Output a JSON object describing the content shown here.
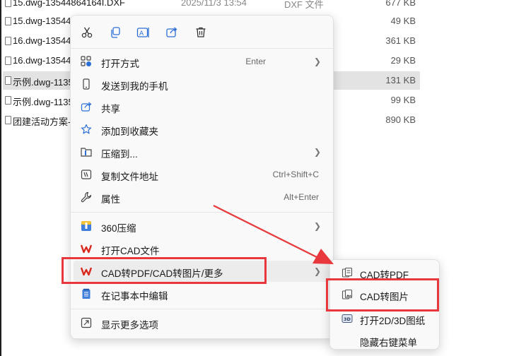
{
  "files": [
    {
      "name": "15.dwg-13544864164I.DXF",
      "date": "2025/11/3 13:54",
      "type": "DXF 文件",
      "size": "677 KB",
      "selected": false
    },
    {
      "name": "15.dwg-13544",
      "date": "",
      "type": "‡",
      "size": "49 KB",
      "selected": false
    },
    {
      "name": "16.dwg-13544",
      "date": "",
      "type": "‡",
      "size": "361 KB",
      "selected": false
    },
    {
      "name": "16.dwg-13544",
      "date": "",
      "type": "‡",
      "size": "29 KB",
      "selected": false
    },
    {
      "name": "示例.dwg-1135",
      "date": "",
      "type": "",
      "size": "131 KB",
      "selected": true
    },
    {
      "name": "示例.dwg-1135",
      "date": "",
      "type": "",
      "size": "99 KB",
      "selected": false
    },
    {
      "name": "团建活动方案-1",
      "date": "",
      "type": "",
      "size": "890 KB",
      "selected": false
    }
  ],
  "quick_actions": [
    "cut-icon",
    "copy-icon",
    "rename-icon",
    "share-icon",
    "delete-icon"
  ],
  "menu": {
    "open_with": {
      "label": "打开方式",
      "shortcut": "Enter"
    },
    "send_to_phone": {
      "label": "发送到我的手机"
    },
    "share": {
      "label": "共享"
    },
    "add_favorites": {
      "label": "添加到收藏夹"
    },
    "compress_to": {
      "label": "压缩到..."
    },
    "copy_path": {
      "label": "复制文件地址",
      "shortcut": "Ctrl+Shift+C"
    },
    "properties": {
      "label": "属性",
      "shortcut": "Alt+Enter"
    },
    "compress_360": {
      "label": "360压缩"
    },
    "open_cad": {
      "label": "打开CAD文件"
    },
    "cad_convert": {
      "label": "CAD转PDF/CAD转图片/更多"
    },
    "edit_notepad": {
      "label": "在记事本中编辑"
    },
    "more_options": {
      "label": "显示更多选项"
    }
  },
  "submenu": {
    "cad_to_pdf": "CAD转PDF",
    "cad_to_image": "CAD转图片",
    "open_2d3d": "打开2D/3D图纸",
    "hide_menu": "隐藏右键菜单"
  },
  "colors": {
    "annotation": "#e8383d",
    "wps_red": "#d9281e",
    "accent_blue": "#2b6fd6"
  }
}
